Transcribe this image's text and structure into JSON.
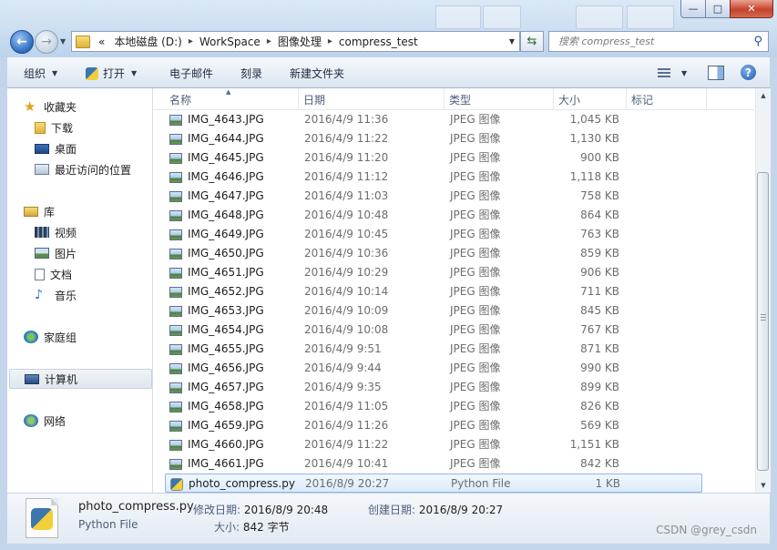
{
  "window": {
    "minimize_label": "—",
    "maximize_label": "□",
    "close_label": "✕"
  },
  "address_bar": {
    "overflow_label": "«",
    "crumbs": [
      "本地磁盘 (D:)",
      "WorkSpace",
      "图像处理",
      "compress_test"
    ],
    "search_placeholder": "搜索 compress_test"
  },
  "toolbar": {
    "organize": "组织",
    "open": "打开",
    "email": "电子邮件",
    "burn": "刻录",
    "new_folder": "新建文件夹"
  },
  "nav": {
    "favorites": "收藏夹",
    "downloads": "下载",
    "desktop": "桌面",
    "recent": "最近访问的位置",
    "libraries": "库",
    "videos": "视频",
    "pictures": "图片",
    "documents": "文档",
    "music": "音乐",
    "homegroup": "家庭组",
    "computer": "计算机",
    "network": "网络"
  },
  "columns": {
    "name": "名称",
    "date": "日期",
    "type": "类型",
    "size": "大小",
    "tags": "标记"
  },
  "files": [
    {
      "name": "IMG_4643.JPG",
      "date": "2016/4/9 11:36",
      "type": "JPEG 图像",
      "size": "1,045 KB"
    },
    {
      "name": "IMG_4644.JPG",
      "date": "2016/4/9 11:22",
      "type": "JPEG 图像",
      "size": "1,130 KB"
    },
    {
      "name": "IMG_4645.JPG",
      "date": "2016/4/9 11:20",
      "type": "JPEG 图像",
      "size": "900 KB"
    },
    {
      "name": "IMG_4646.JPG",
      "date": "2016/4/9 11:12",
      "type": "JPEG 图像",
      "size": "1,118 KB"
    },
    {
      "name": "IMG_4647.JPG",
      "date": "2016/4/9 11:03",
      "type": "JPEG 图像",
      "size": "758 KB"
    },
    {
      "name": "IMG_4648.JPG",
      "date": "2016/4/9 10:48",
      "type": "JPEG 图像",
      "size": "864 KB"
    },
    {
      "name": "IMG_4649.JPG",
      "date": "2016/4/9 10:45",
      "type": "JPEG 图像",
      "size": "763 KB"
    },
    {
      "name": "IMG_4650.JPG",
      "date": "2016/4/9 10:36",
      "type": "JPEG 图像",
      "size": "859 KB"
    },
    {
      "name": "IMG_4651.JPG",
      "date": "2016/4/9 10:29",
      "type": "JPEG 图像",
      "size": "906 KB"
    },
    {
      "name": "IMG_4652.JPG",
      "date": "2016/4/9 10:14",
      "type": "JPEG 图像",
      "size": "711 KB"
    },
    {
      "name": "IMG_4653.JPG",
      "date": "2016/4/9 10:09",
      "type": "JPEG 图像",
      "size": "845 KB"
    },
    {
      "name": "IMG_4654.JPG",
      "date": "2016/4/9 10:08",
      "type": "JPEG 图像",
      "size": "767 KB"
    },
    {
      "name": "IMG_4655.JPG",
      "date": "2016/4/9 9:51",
      "type": "JPEG 图像",
      "size": "871 KB"
    },
    {
      "name": "IMG_4656.JPG",
      "date": "2016/4/9 9:44",
      "type": "JPEG 图像",
      "size": "990 KB"
    },
    {
      "name": "IMG_4657.JPG",
      "date": "2016/4/9 9:35",
      "type": "JPEG 图像",
      "size": "899 KB"
    },
    {
      "name": "IMG_4658.JPG",
      "date": "2016/4/9 11:05",
      "type": "JPEG 图像",
      "size": "826 KB"
    },
    {
      "name": "IMG_4659.JPG",
      "date": "2016/4/9 11:26",
      "type": "JPEG 图像",
      "size": "569 KB"
    },
    {
      "name": "IMG_4660.JPG",
      "date": "2016/4/9 11:22",
      "type": "JPEG 图像",
      "size": "1,151 KB"
    },
    {
      "name": "IMG_4661.JPG",
      "date": "2016/4/9 10:41",
      "type": "JPEG 图像",
      "size": "842 KB"
    },
    {
      "name": "photo_compress.py",
      "date": "2016/8/9 20:27",
      "type": "Python File",
      "size": "1 KB"
    }
  ],
  "details": {
    "name": "photo_compress.py",
    "type": "Python File",
    "modified_label": "修改日期:",
    "modified_value": "2016/8/9 20:48",
    "created_label": "创建日期:",
    "created_value": "2016/8/9 20:27",
    "size_label": "大小:",
    "size_value": "842 字节"
  },
  "watermark": "CSDN @grey_csdn"
}
